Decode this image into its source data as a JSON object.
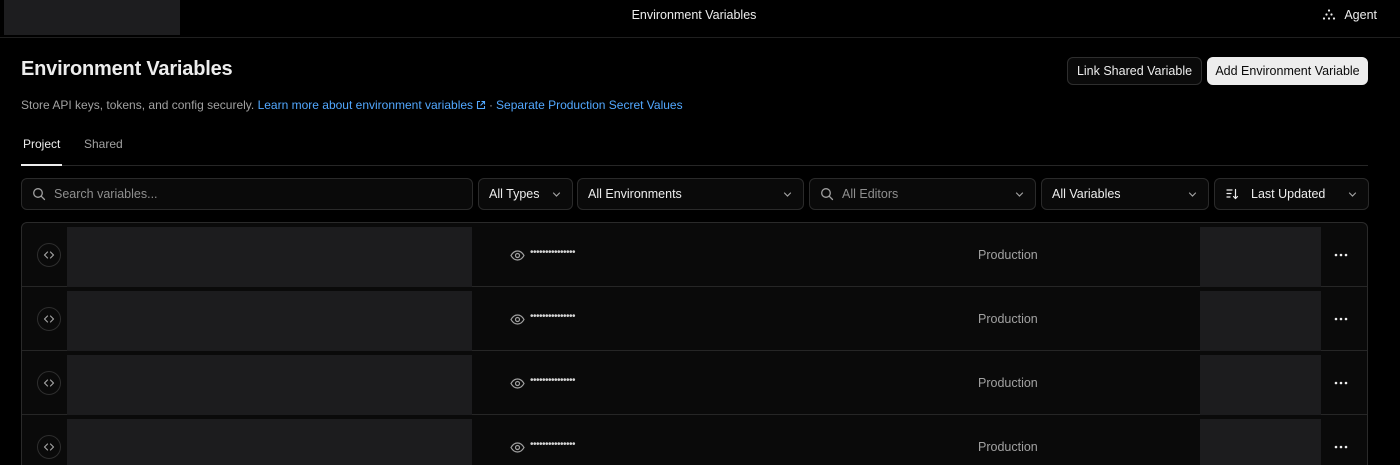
{
  "topbar": {
    "title": "Environment Variables",
    "agent_label": "Agent"
  },
  "header": {
    "title": "Environment Variables",
    "link_shared_label": "Link Shared Variable",
    "add_env_label": "Add Environment Variable",
    "description": "Store API keys, tokens, and config securely.",
    "learn_more_link": "Learn more about environment variables",
    "separator": "·",
    "secret_values_link": "Separate Production Secret Values"
  },
  "tabs": {
    "project": "Project",
    "shared": "Shared",
    "active": "project"
  },
  "filters": {
    "search_placeholder": "Search variables...",
    "types": "All Types",
    "environments": "All Environments",
    "editors_placeholder": "All Editors",
    "variables": "All Variables",
    "sort": "Last Updated"
  },
  "rows": [
    {
      "type_icon": "code-icon",
      "masked_value": "•••••••••••••••",
      "environment": "Production"
    },
    {
      "type_icon": "code-icon",
      "masked_value": "•••••••••••••••",
      "environment": "Production"
    },
    {
      "type_icon": "code-icon",
      "masked_value": "•••••••••••••••",
      "environment": "Production"
    },
    {
      "type_icon": "code-icon",
      "masked_value": "•••••••••••••••",
      "environment": "Production"
    }
  ],
  "colors": {
    "background": "#000000",
    "link": "#52a8ff",
    "primary_button": "#ededed",
    "muted_text": "#a1a1a1",
    "border": "#2a2a2a"
  }
}
